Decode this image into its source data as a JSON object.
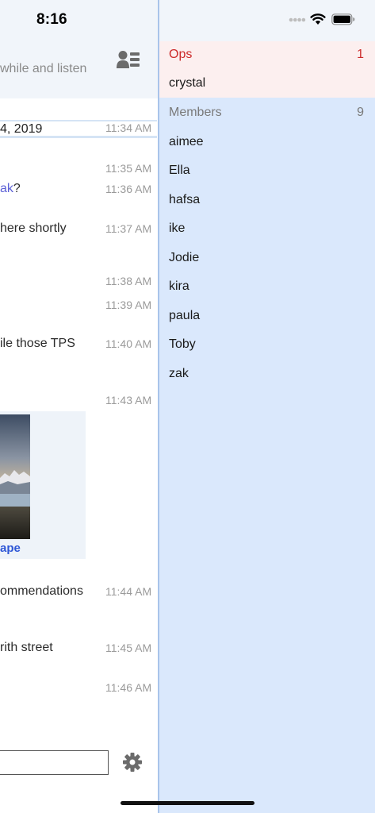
{
  "status_bar": {
    "time": "8:16"
  },
  "chat": {
    "topic": "while and listen",
    "date": "4, 2019",
    "messages": [
      {
        "text": "",
        "time": "11:34 AM"
      },
      {
        "text": "",
        "time": "11:35 AM"
      },
      {
        "text_before": "",
        "mention": "ak",
        "text_after": "?",
        "time": "11:36 AM"
      },
      {
        "text": " here shortly",
        "time": "11:37 AM"
      },
      {
        "text": "",
        "time": "11:38 AM"
      },
      {
        "text": "",
        "time": "11:39 AM"
      },
      {
        "text": "ile those TPS",
        "time": "11:40 AM"
      },
      {
        "text": "",
        "time": "11:43 AM"
      },
      {
        "text": "ommendations",
        "time": "11:44 AM"
      },
      {
        "text": "rith street",
        "time": "11:45 AM"
      },
      {
        "text": "",
        "time": "11:46 AM"
      }
    ],
    "image_link": "ape",
    "input": {
      "value": "",
      "placeholder": ""
    },
    "icons": {
      "user_list": "user-list-icon",
      "settings": "gear-icon",
      "image": "landscape-photo"
    }
  },
  "members_panel": {
    "ops": {
      "title": "Ops",
      "count": "1",
      "users": [
        "crystal"
      ]
    },
    "members": {
      "title": "Members",
      "count": "9",
      "users": [
        "aimee",
        "Ella",
        "hafsa",
        "ike",
        "Jodie",
        "kira",
        "paula",
        "Toby",
        "zak"
      ]
    }
  },
  "colors": {
    "ops_background": "#fcefef",
    "ops_text": "#cc2a2a",
    "members_background": "#dae8fc",
    "header_background": "#f1f5fa",
    "mention": "#5b5fd6",
    "link": "#2f57d6"
  }
}
